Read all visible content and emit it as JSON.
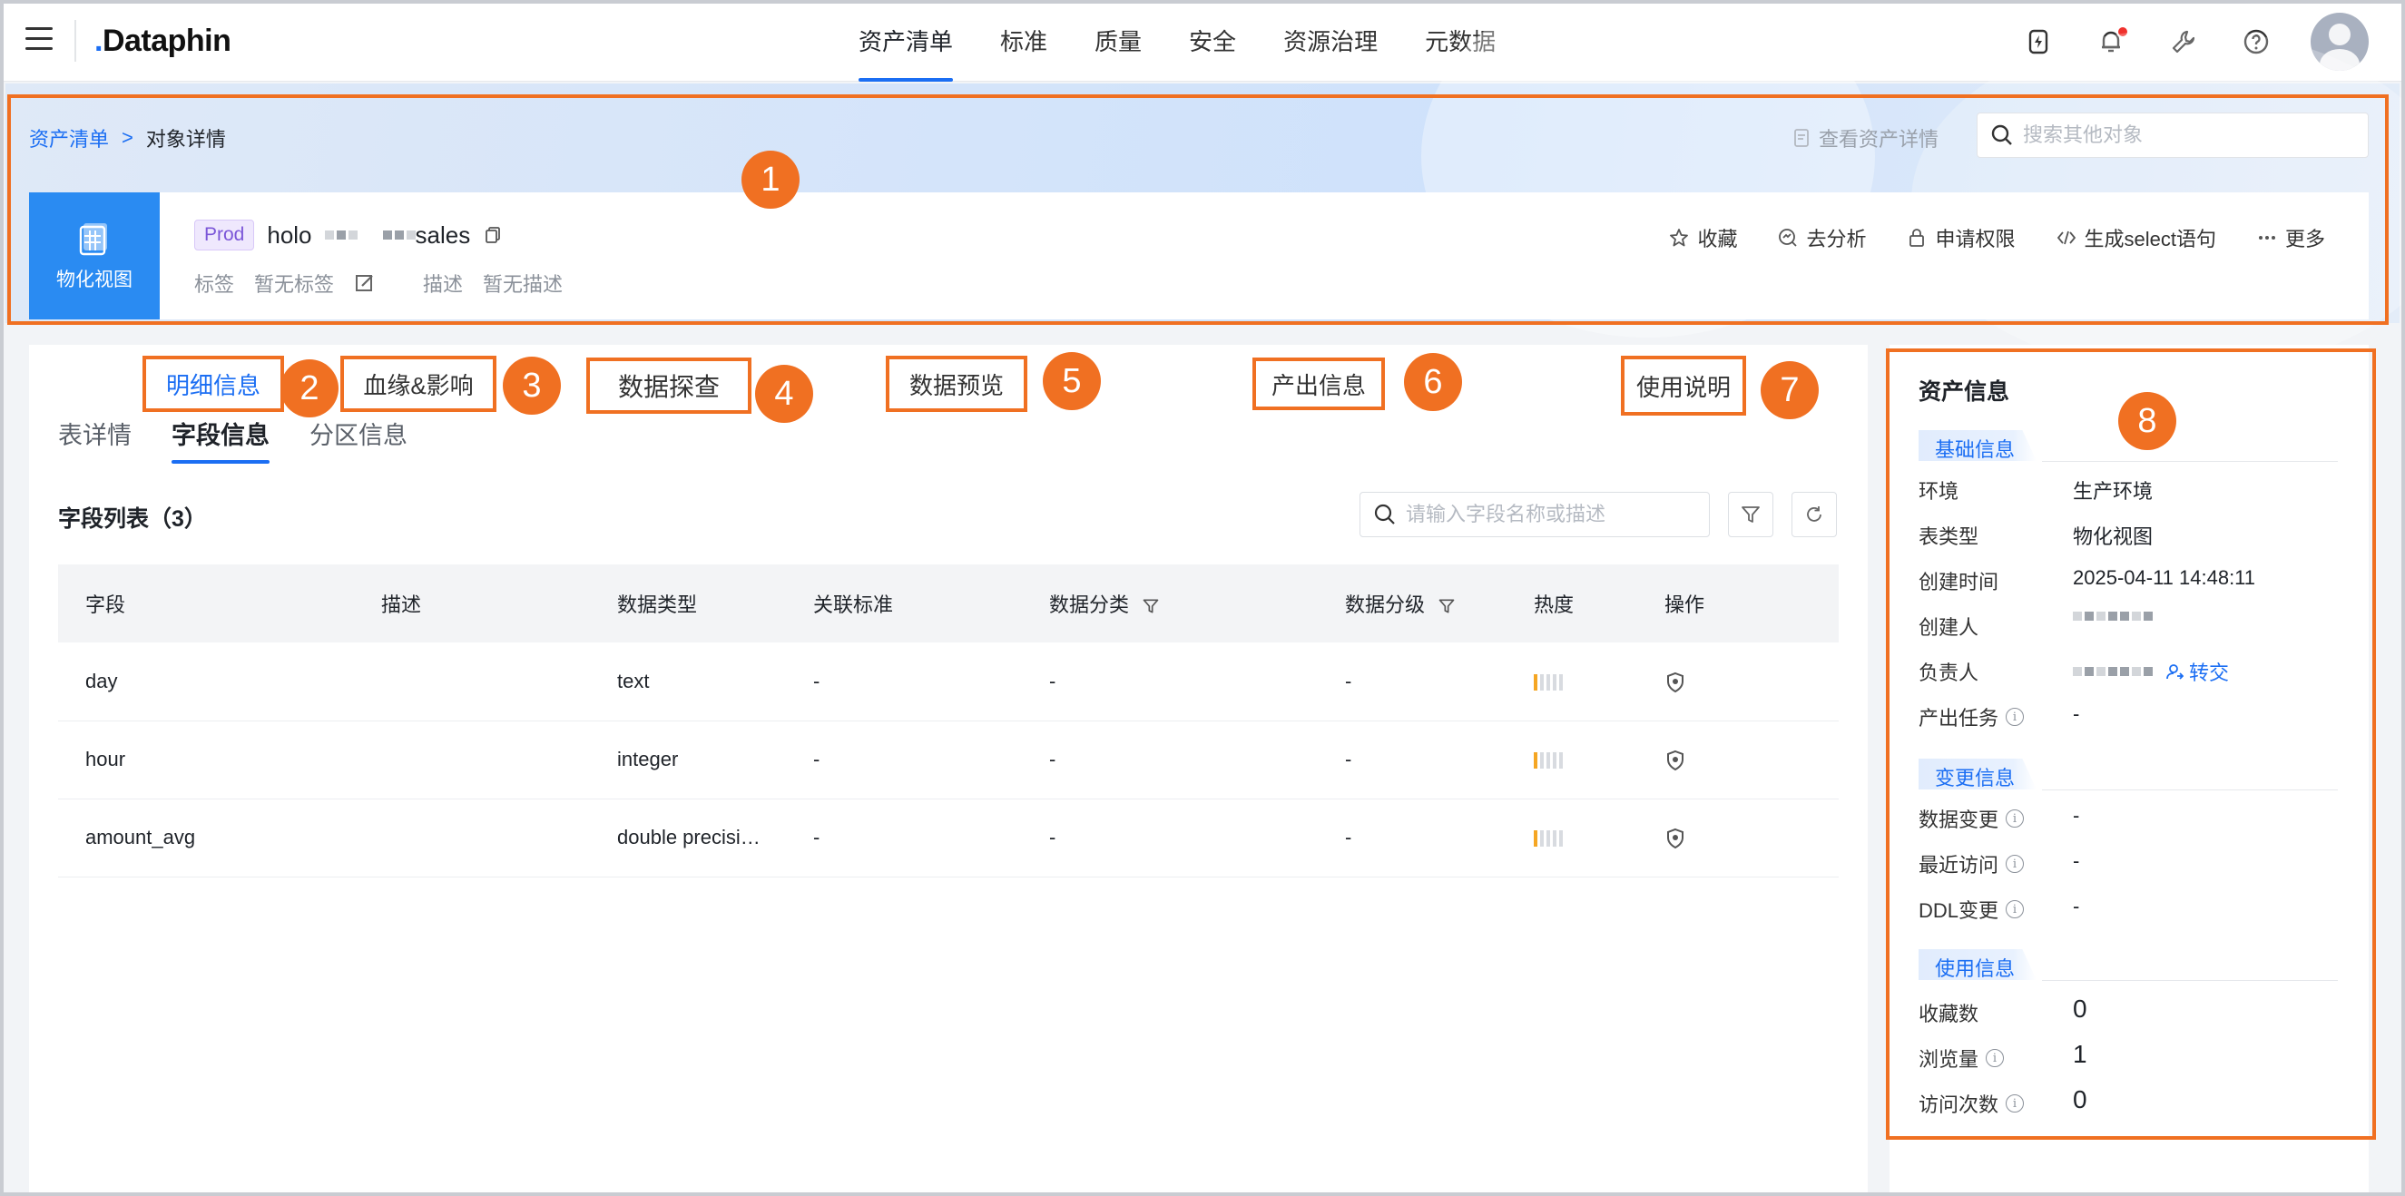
{
  "topnav": {
    "logo": "Dataphin",
    "tabs": [
      "资产清单",
      "标准",
      "质量",
      "安全",
      "资源治理",
      "元数据"
    ],
    "active_tab": "资产清单",
    "icons": [
      "flash-icon",
      "bell-icon",
      "wrench-icon",
      "help-icon",
      "avatar"
    ]
  },
  "header": {
    "breadcrumb": {
      "root": "资产清单",
      "sep": ">",
      "current": "对象详情"
    },
    "view_detail": "查看资产详情",
    "search_placeholder": "搜索其他对象",
    "object": {
      "type_label": "物化视图",
      "env_tag": "Prod",
      "name_start": "holo",
      "name_end": "sales",
      "tag_label": "标签",
      "tag_value": "暂无标签",
      "desc_label": "描述",
      "desc_value": "暂无描述"
    },
    "actions": [
      "收藏",
      "去分析",
      "申请权限",
      "生成select语句",
      "更多"
    ]
  },
  "annotations": {
    "tabs": [
      "明细信息",
      "血缘&影响",
      "数据探查",
      "数据预览",
      "产出信息",
      "使用说明"
    ],
    "numbers": [
      "1",
      "2",
      "3",
      "4",
      "5",
      "6",
      "7",
      "8"
    ]
  },
  "main": {
    "subtabs": [
      "表详情",
      "字段信息",
      "分区信息"
    ],
    "active_subtab": "字段信息",
    "field_list_title": "字段列表（3）",
    "field_search_placeholder": "请输入字段名称或描述",
    "columns": [
      "字段",
      "描述",
      "数据类型",
      "关联标准",
      "数据分类",
      "数据分级",
      "热度",
      "操作"
    ],
    "rows": [
      {
        "field": "day",
        "desc": "",
        "type": "text",
        "standard": "-",
        "category": "-",
        "level": "-",
        "heat": 1
      },
      {
        "field": "hour",
        "desc": "",
        "type": "integer",
        "standard": "-",
        "category": "-",
        "level": "-",
        "heat": 1
      },
      {
        "field": "amount_avg",
        "desc": "",
        "type": "double precisi…",
        "standard": "-",
        "category": "-",
        "level": "-",
        "heat": 1
      }
    ],
    "heat_max": 5
  },
  "asset_info": {
    "title": "资产信息",
    "sections": {
      "basic": "基础信息",
      "change": "变更信息",
      "usage": "使用信息"
    },
    "basic": [
      {
        "label": "环境",
        "value": "生产环境"
      },
      {
        "label": "表类型",
        "value": "物化视图"
      },
      {
        "label": "创建时间",
        "value": "2025-04-11 14:48:11"
      },
      {
        "label": "创建人",
        "value": ""
      },
      {
        "label": "负责人",
        "value": ""
      },
      {
        "label": "产出任务",
        "value": "-"
      }
    ],
    "transfer_label": "转交",
    "change": [
      {
        "label": "数据变更",
        "value": "-"
      },
      {
        "label": "最近访问",
        "value": "-"
      },
      {
        "label": "DDL变更",
        "value": "-"
      }
    ],
    "usage": [
      {
        "label": "收藏数",
        "value": "0"
      },
      {
        "label": "浏览量",
        "value": "1"
      },
      {
        "label": "访问次数",
        "value": "0"
      }
    ]
  },
  "colors": {
    "accent": "#1b6ef3",
    "annotation": "#f07022",
    "object_icon_bg": "#2a8bf2",
    "prod_tag": "#7b56d8",
    "heat_on": "#f5a623"
  }
}
